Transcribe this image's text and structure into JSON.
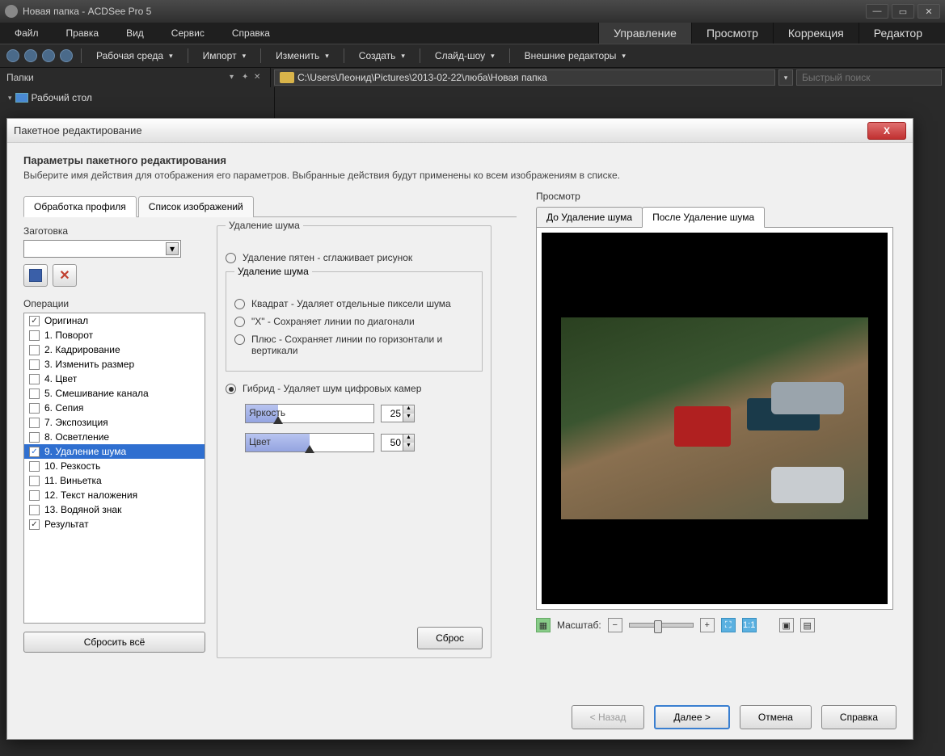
{
  "app": {
    "title": "Новая папка - ACDSee Pro 5"
  },
  "menubar": {
    "file": "Файл",
    "edit": "Правка",
    "view": "Вид",
    "service": "Сервис",
    "help": "Справка"
  },
  "right_tabs": {
    "manage": "Управление",
    "view": "Просмотр",
    "develop": "Коррекция",
    "edit": "Редактор"
  },
  "toolbar": {
    "workspace": "Рабочая среда",
    "import": "Импорт",
    "modify": "Изменить",
    "create": "Создать",
    "slideshow": "Слайд-шоу",
    "external": "Внешние редакторы"
  },
  "folders": {
    "label": "Папки",
    "desktop": "Рабочий стол"
  },
  "path": "C:\\Users\\Леонид\\Pictures\\2013-02-22\\люба\\Новая папка",
  "search": {
    "placeholder": "Быстрый поиск"
  },
  "dialog": {
    "title": "Пакетное редактирование",
    "heading": "Параметры пакетного редактирования",
    "sub": "Выберите имя действия для отображения его параметров. Выбранные действия будут применены ко всем изображениям в списке.",
    "tabs": {
      "profile": "Обработка профиля",
      "images": "Список изображений"
    },
    "preset_label": "Заготовка",
    "ops_label": "Операции",
    "ops": [
      {
        "label": "Оригинал",
        "checked": true
      },
      {
        "label": "1. Поворот",
        "checked": false
      },
      {
        "label": "2. Кадрирование",
        "checked": false
      },
      {
        "label": "3. Изменить размер",
        "checked": false
      },
      {
        "label": "4. Цвет",
        "checked": false
      },
      {
        "label": "5. Смешивание канала",
        "checked": false
      },
      {
        "label": "6. Сепия",
        "checked": false
      },
      {
        "label": "7. Экспозиция",
        "checked": false
      },
      {
        "label": "8. Осветление",
        "checked": false
      },
      {
        "label": "9. Удаление шума",
        "checked": true,
        "selected": true
      },
      {
        "label": "10. Резкость",
        "checked": false
      },
      {
        "label": "11. Виньетка",
        "checked": false
      },
      {
        "label": "12. Текст наложения",
        "checked": false
      },
      {
        "label": "13. Водяной знак",
        "checked": false
      },
      {
        "label": "Результат",
        "checked": true
      }
    ],
    "reset_all": "Сбросить всё",
    "noise": {
      "group": "Удаление шума",
      "despeckle": "Удаление пятен - сглаживает рисунок",
      "inner_group": "Удаление шума",
      "square": "Квадрат - Удаляет отдельные пиксели шума",
      "x": "\"X\" - Сохраняет линии по диагонали",
      "plus": "Плюс - Сохраняет линии по горизонтали и вертикали",
      "hybrid": "Гибрид - Удаляет шум цифровых камер",
      "brightness_label": "Яркость",
      "brightness_value": "25",
      "color_label": "Цвет",
      "color_value": "50",
      "reset": "Сброс"
    },
    "preview": {
      "label": "Просмотр",
      "before": "До Удаление шума",
      "after": "После Удаление шума",
      "zoom": "Масштаб:"
    },
    "footer": {
      "back": "< Назад",
      "next": "Далее >",
      "cancel": "Отмена",
      "help": "Справка"
    }
  }
}
